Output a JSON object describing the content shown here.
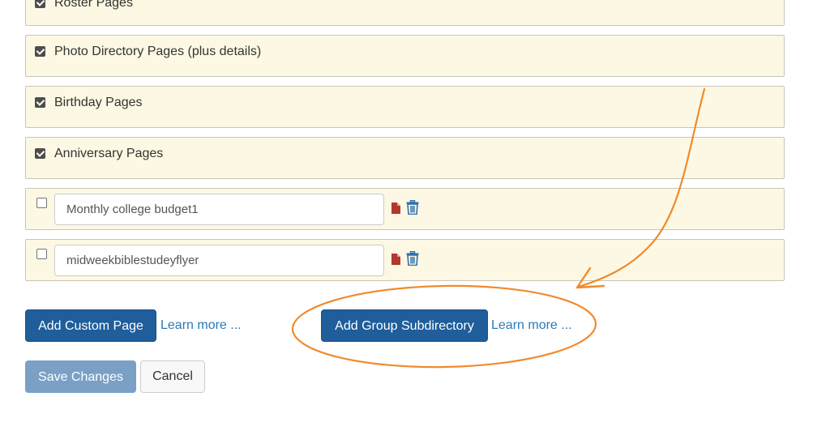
{
  "panels": [
    {
      "label": "Roster Pages",
      "checked": true
    },
    {
      "label": "Photo Directory Pages (plus details)",
      "checked": true
    },
    {
      "label": "Birthday Pages",
      "checked": true
    },
    {
      "label": "Anniversary Pages",
      "checked": true
    }
  ],
  "custom_pages": [
    {
      "value": "Monthly college budget1",
      "checked": false
    },
    {
      "value": "midweekbiblestudeyflyer",
      "checked": false
    }
  ],
  "actions": {
    "add_custom_page": "Add Custom Page",
    "learn_more_1": "Learn more ...",
    "add_group_subdirectory": "Add Group Subdirectory",
    "learn_more_2": "Learn more ..."
  },
  "footer": {
    "save": "Save Changes",
    "cancel": "Cancel"
  },
  "colors": {
    "panel_bg": "#fcf8e3",
    "primary": "#1f5d9b",
    "annotation": "#f08a2c",
    "pdf_icon": "#b0382e",
    "trash_icon": "#2f6fae"
  },
  "icons": [
    "checkbox-checked-icon",
    "checkbox-unchecked-icon",
    "file-pdf-icon",
    "trash-icon"
  ]
}
